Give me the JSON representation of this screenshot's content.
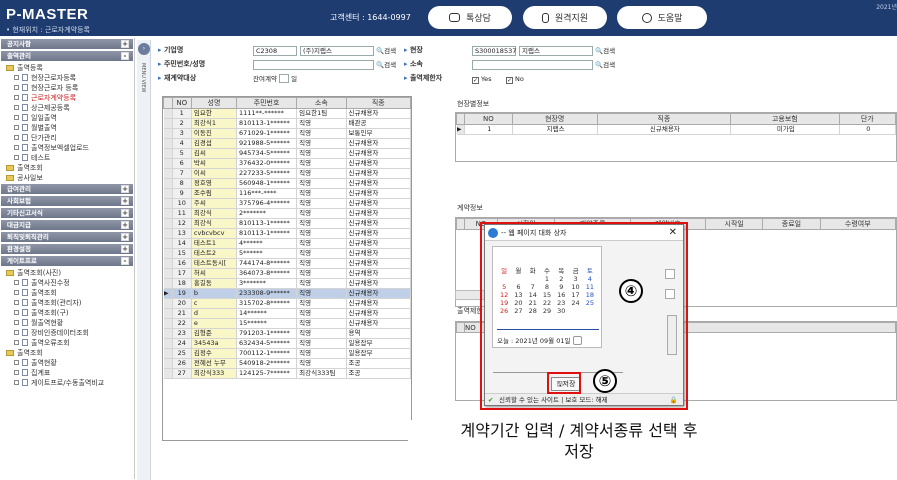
{
  "header": {
    "logo": "P-MASTER",
    "location": "• 현재위치 : 근로자계약등록",
    "callcenter": "고객센터 : 1644-0997",
    "buttons": [
      "톡상담",
      "원격지원",
      "도움말"
    ],
    "year": "2021년"
  },
  "sidebar": {
    "sections": [
      {
        "label": "공지사항",
        "toggle": "+"
      },
      {
        "label": "출역관리",
        "toggle": "-"
      }
    ],
    "tree1": [
      {
        "label": "출역등록",
        "kind": "folder",
        "indent": 0
      },
      {
        "label": "현장근로자등록",
        "kind": "doc",
        "indent": 1
      },
      {
        "label": "현장근로자 등록",
        "kind": "doc",
        "indent": 1
      },
      {
        "label": "근로자계약등록",
        "kind": "doc",
        "indent": 1,
        "active": true
      },
      {
        "label": "상근제공등록",
        "kind": "doc",
        "indent": 1
      },
      {
        "label": "일일출역",
        "kind": "doc",
        "indent": 1
      },
      {
        "label": "월별출역",
        "kind": "doc",
        "indent": 1
      },
      {
        "label": "단가관리",
        "kind": "doc",
        "indent": 1
      },
      {
        "label": "출역정보엑셀업로드",
        "kind": "doc",
        "indent": 1
      },
      {
        "label": "테스트",
        "kind": "doc",
        "indent": 1
      },
      {
        "label": "출역조회",
        "kind": "folder",
        "indent": 0
      },
      {
        "label": "공사일보",
        "kind": "folder",
        "indent": 0
      }
    ],
    "sections2": [
      {
        "label": "급여관리",
        "toggle": "+"
      },
      {
        "label": "사회보험",
        "toggle": "+"
      },
      {
        "label": "기타신고서식",
        "toggle": "+"
      },
      {
        "label": "대금지급",
        "toggle": "+"
      },
      {
        "label": "퇴직및퇴직관리",
        "toggle": "+"
      },
      {
        "label": "환경설정",
        "toggle": "+"
      },
      {
        "label": "게이트프로",
        "toggle": "-"
      }
    ],
    "tree2": [
      {
        "label": "출역조회(사진)",
        "kind": "folder",
        "indent": 0
      },
      {
        "label": "출역사진수정",
        "kind": "doc",
        "indent": 1
      },
      {
        "label": "출역조회",
        "kind": "doc",
        "indent": 1
      },
      {
        "label": "출역조회(관리자)",
        "kind": "doc",
        "indent": 1
      },
      {
        "label": "출역조회(구)",
        "kind": "doc",
        "indent": 1
      },
      {
        "label": "월출역현황",
        "kind": "doc",
        "indent": 1
      },
      {
        "label": "장비인증데이터조회",
        "kind": "doc",
        "indent": 1
      },
      {
        "label": "출역오류조회",
        "kind": "doc",
        "indent": 1
      },
      {
        "label": "출역조회",
        "kind": "folder",
        "indent": 0
      },
      {
        "label": "출역현황",
        "kind": "doc",
        "indent": 1
      },
      {
        "label": "집계표",
        "kind": "doc",
        "indent": 1
      },
      {
        "label": "게이트프로/수동출역비교",
        "kind": "doc",
        "indent": 1
      }
    ]
  },
  "menuview": "MENU VIEW",
  "search": {
    "company_label": "기업명",
    "company_code": "C2308",
    "company_name": "(주)지랩스",
    "search_btn": "검색",
    "site_label": "현장",
    "site_code": "S300018537",
    "site_name": "지랩스",
    "resident_label": "주민번호/성명",
    "affil_label": "소속",
    "target_label": "재계약대상",
    "target_value": "잔여계약",
    "target_unit": "일",
    "limit_label": "출역제한자",
    "yes": "Yes",
    "no": "No"
  },
  "grid": {
    "headers": [
      "NO",
      "성명",
      "주민번호",
      "소속",
      "직종"
    ],
    "rows": [
      [
        "1",
        "임요한",
        "1111**-******",
        "임요한1팀",
        "신규채용자"
      ],
      [
        "2",
        "최강식1",
        "810113-1******",
        "직영",
        "배관공"
      ],
      [
        "3",
        "이동진",
        "671029-1******",
        "직영",
        "보통인부"
      ],
      [
        "4",
        "김경섭",
        "921988-5******",
        "직영",
        "신규채용자"
      ],
      [
        "5",
        "김씨",
        "945734-5******",
        "직영",
        "신규채용자"
      ],
      [
        "6",
        "박씨",
        "376432-0******",
        "직영",
        "신규채용자"
      ],
      [
        "7",
        "이씨",
        "227233-5******",
        "직영",
        "신규채용자"
      ],
      [
        "8",
        "정호영",
        "560948-1******",
        "직영",
        "신규채용자"
      ],
      [
        "9",
        "조수림",
        "116***-****",
        "직영",
        "신규채용자"
      ],
      [
        "10",
        "주씨",
        "375796-4******",
        "직영",
        "신규채용자"
      ],
      [
        "11",
        "최강식",
        "2*******",
        "직영",
        "신규채용자"
      ],
      [
        "12",
        "최강식",
        "810113-1******",
        "직영",
        "신규채용자"
      ],
      [
        "13",
        "cvbcvbcv",
        "810113-1******",
        "직영",
        "신규채용자"
      ],
      [
        "14",
        "테스트1",
        "4******",
        "직영",
        "신규채용자"
      ],
      [
        "15",
        "테스트2",
        "5******",
        "직영",
        "신규채용자"
      ],
      [
        "16",
        "테스트동시[",
        "744174-8******",
        "직영",
        "신규채용자"
      ],
      [
        "17",
        "허씨",
        "364073-8******",
        "직영",
        "신규채용자"
      ],
      [
        "18",
        "홍길동",
        "3*******",
        "직영",
        "신규채용자"
      ],
      [
        "19",
        "b",
        "233308-9******",
        "직영",
        "신규채용자"
      ],
      [
        "20",
        "c",
        "315702-8******",
        "직영",
        "신규채용자"
      ],
      [
        "21",
        "d",
        "14******",
        "직영",
        "신규채용자"
      ],
      [
        "22",
        "e",
        "15******",
        "직영",
        "신규채용자"
      ],
      [
        "23",
        "김형준",
        "791203-1******",
        "직영",
        "용역"
      ],
      [
        "24",
        "34543a",
        "632434-5******",
        "직영",
        "일용잡부"
      ],
      [
        "25",
        "김정수",
        "700112-1******",
        "직영",
        "일용잡부"
      ],
      [
        "26",
        "전혜선 누무",
        "540918-2******",
        "직영",
        "조공"
      ],
      [
        "27",
        "최강식333",
        "124125-7******",
        "최강식333팀",
        "조공"
      ]
    ],
    "current_row": 19
  },
  "right": {
    "site_info_title": "현장별정보",
    "site_headers": [
      "NO",
      "현장명",
      "직종",
      "고용보험",
      "단가"
    ],
    "site_row": [
      "1",
      "지랩스",
      "신규채용자",
      "미가입",
      "0"
    ],
    "contract_title": "계약정보",
    "contract_headers": [
      "NO",
      "시작일",
      "계약종류",
      "계약번호",
      "시작일",
      "종료일",
      "수령여부"
    ],
    "out_title": "출역제한"
  },
  "dialog": {
    "title": "-- 웹 페이지 대화 상자",
    "year_label": "년도",
    "year": "2021",
    "month_label": "월",
    "month": "09",
    "weekdays": [
      "일",
      "월",
      "화",
      "수",
      "목",
      "금",
      "토"
    ],
    "days": [
      "",
      "",
      "",
      "1",
      "2",
      "3",
      "4",
      "5",
      "6",
      "7",
      "8",
      "9",
      "10",
      "11",
      "12",
      "13",
      "14",
      "15",
      "16",
      "17",
      "18",
      "19",
      "20",
      "21",
      "22",
      "23",
      "24",
      "25",
      "26",
      "27",
      "28",
      "29",
      "30",
      "",
      ""
    ],
    "today": "오늘 : 2021년 09월 01일",
    "save": "저장",
    "status": "신뢰할 수 있는 사이트 | 보호 모드: 해제"
  },
  "callouts": {
    "c4": "④",
    "c5": "⑤"
  },
  "caption": [
    "계약기간 입력 / 계약서종류 선택 후",
    "저장"
  ]
}
